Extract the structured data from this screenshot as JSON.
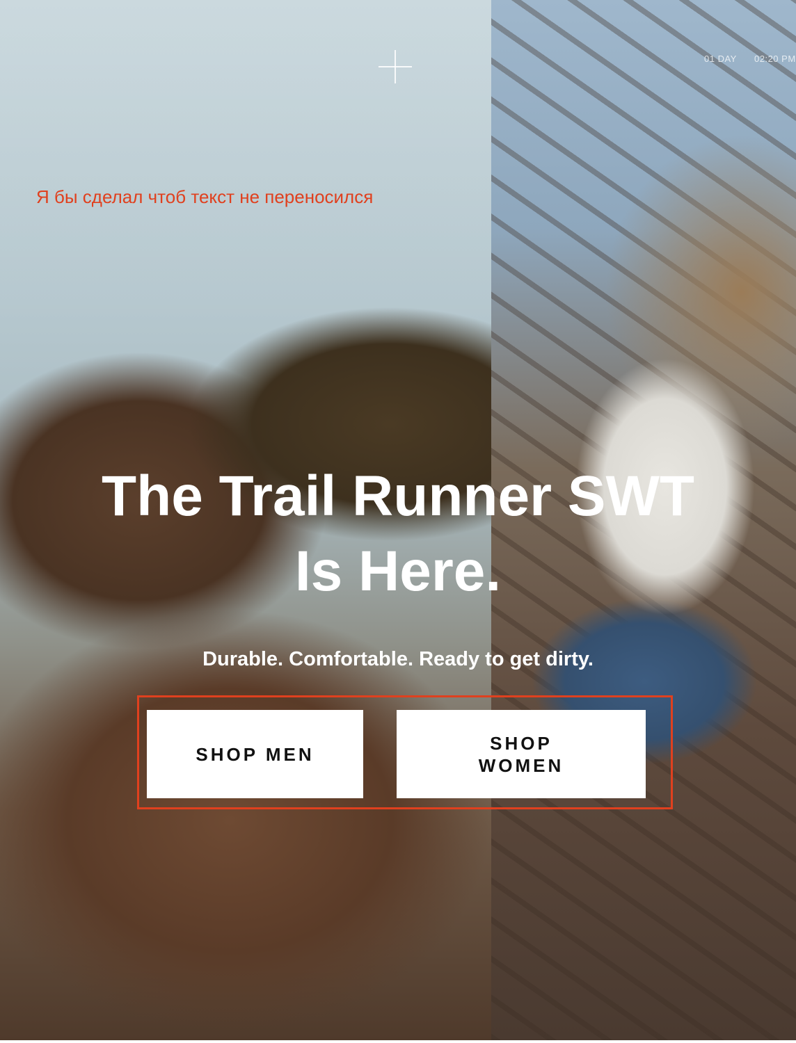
{
  "annotation": {
    "note": "Я бы сделал чтоб текст не переносился",
    "highlight_color": "#e0401e"
  },
  "hero": {
    "title_line1": "The Trail Runner SWT",
    "title_line2": "Is Here.",
    "subtitle": "Durable. Comfortable. Ready to get dirty."
  },
  "buttons": {
    "shop_men": "SHOP MEN",
    "shop_women": "SHOP WOMEN"
  },
  "photo_overlay": {
    "day_label": "01 DAY",
    "time_label": "02:20 PM"
  }
}
